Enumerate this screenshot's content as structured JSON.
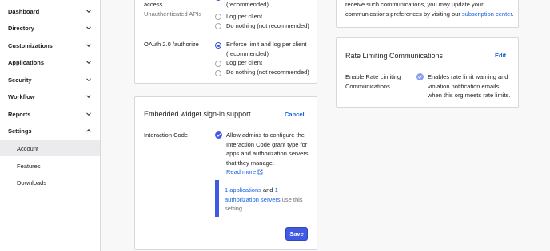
{
  "sidebar": {
    "items": [
      {
        "label": "Dashboard",
        "expanded": false
      },
      {
        "label": "Directory",
        "expanded": false
      },
      {
        "label": "Customizations",
        "expanded": false
      },
      {
        "label": "Applications",
        "expanded": false
      },
      {
        "label": "Security",
        "expanded": false
      },
      {
        "label": "Workflow",
        "expanded": false
      },
      {
        "label": "Reports",
        "expanded": false
      },
      {
        "label": "Settings",
        "expanded": true
      }
    ],
    "sub_items": [
      {
        "label": "Account",
        "active": true
      },
      {
        "label": "Features",
        "active": false
      },
      {
        "label": "Downloads",
        "active": false
      }
    ]
  },
  "top_panel": {
    "row1_label_line1": "access",
    "row1_label_line2": "Unauthenticated APIs",
    "row1_option_cont": "(recommended)",
    "row1_options": [
      "Log per client",
      "Do nothing (not recommended)"
    ],
    "row2_label": "OAuth 2.0 /authorize",
    "row2_options": [
      {
        "label_line1": "Enforce limit and log per client",
        "label_line2": "(recommended)",
        "selected": true
      },
      {
        "label_line1": "Log per client",
        "selected": false
      },
      {
        "label_line1": "Do nothing (not recommended)",
        "selected": false
      }
    ]
  },
  "widget_panel": {
    "title": "Embedded widget sign-in support",
    "cancel_label": "Cancel",
    "field_label": "Interaction Code",
    "checkbox_checked": true,
    "checkbox_text": [
      "Allow admins to configure the",
      "Interaction Code grant type for",
      "apps and authorization servers",
      "that they manage."
    ],
    "read_more_label": "Read more",
    "callout": {
      "apps_link": "1 applications",
      "and_text": " and ",
      "one_link": "1",
      "servers_link": "authorization servers",
      "use_text": " use this",
      "setting_text": "setting"
    },
    "save_label": "Save"
  },
  "comms_panel": {
    "text_line1": "receive such communications, you may update your",
    "text_line2_prefix": "communications preferences by visiting our ",
    "subscription_link": "subscription center",
    "text_line2_suffix": "."
  },
  "rate_panel": {
    "title": "Rate Limiting Communications",
    "edit_label": "Edit",
    "field_label_line1": "Enable Rate Limiting",
    "field_label_line2": "Communications",
    "checkbox_checked": true,
    "checkbox_text": [
      "Enables rate limit warning and",
      "violation notification emails",
      "when this org meets rate limits."
    ]
  },
  "colors": {
    "accent": "#3f59e4",
    "link": "#1662dd",
    "border": "#d7d7dc",
    "active_bg": "#ebebed"
  }
}
